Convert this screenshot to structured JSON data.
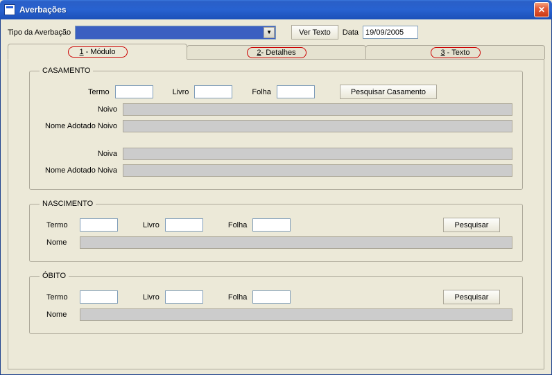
{
  "window": {
    "title": "Averbações"
  },
  "toolbar": {
    "tipo_label": "Tipo da Averbação",
    "combo_value": "",
    "ver_texto": "Ver Texto",
    "data_label": "Data",
    "data_value": "19/09/2005"
  },
  "tabs": {
    "t1": "1 - Módulo",
    "t2": "2- Detalhes",
    "t3": "3 - Texto"
  },
  "casamento": {
    "legend": "CASAMENTO",
    "termo_label": "Termo",
    "livro_label": "Livro",
    "folha_label": "Folha",
    "pesquisar": "Pesquisar Casamento",
    "noivo_label": "Noivo",
    "nome_adot_noivo_label": "Nome Adotado Noivo",
    "noiva_label": "Noiva",
    "nome_adot_noiva_label": "Nome Adotado Noiva",
    "termo": "",
    "livro": "",
    "folha": "",
    "noivo": "",
    "nome_adot_noivo": "",
    "noiva": "",
    "nome_adot_noiva": ""
  },
  "nascimento": {
    "legend": "NASCIMENTO",
    "termo_label": "Termo",
    "livro_label": "Livro",
    "folha_label": "Folha",
    "pesquisar": "Pesquisar",
    "nome_label": "Nome",
    "termo": "",
    "livro": "",
    "folha": "",
    "nome": ""
  },
  "obito": {
    "legend": "ÓBITO",
    "termo_label": "Termo",
    "livro_label": "Livro",
    "folha_label": "Folha",
    "pesquisar": "Pesquisar",
    "nome_label": "Nome",
    "termo": "",
    "livro": "",
    "folha": "",
    "nome": ""
  }
}
